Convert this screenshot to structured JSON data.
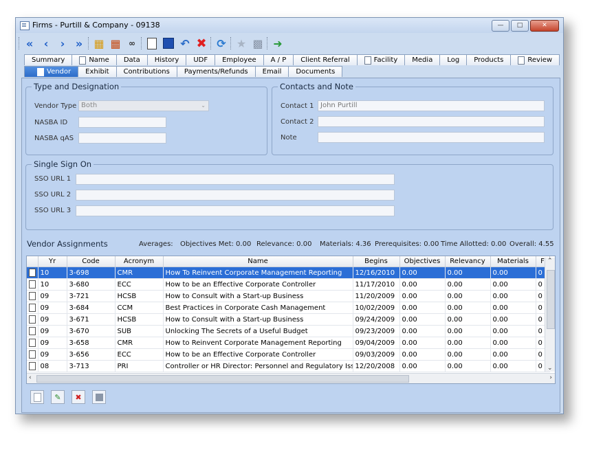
{
  "window": {
    "title": "Firms - Purtill & Company - 09138"
  },
  "toolbar": {
    "icons": [
      "first-icon",
      "prev-icon",
      "next-icon",
      "last-icon",
      "book-icon",
      "open-folder-icon",
      "glasses-icon",
      "new-document-icon",
      "save-icon",
      "undo-icon",
      "delete-icon",
      "refresh-icon",
      "star-icon",
      "printer-icon",
      "exit-icon"
    ]
  },
  "tabs_row1": [
    "Summary",
    "Name",
    "Data",
    "History",
    "UDF",
    "Employee",
    "A / P",
    "Client Referral",
    "Facility",
    "Media",
    "Log",
    "Products",
    "Review"
  ],
  "tabs_row2": [
    "Vendor",
    "Exhibit",
    "Contributions",
    "Payments/Refunds",
    "Email",
    "Documents"
  ],
  "type_designation": {
    "title": "Type and Designation",
    "vendor_type_label": "Vendor Type",
    "vendor_type_value": "Both",
    "nasba_id_label": "NASBA ID",
    "nasba_id_value": "",
    "nasba_qas_label": "NASBA qAS",
    "nasba_qas_value": ""
  },
  "contacts": {
    "title": "Contacts and Note",
    "contact1_label": "Contact 1",
    "contact1_value": "John Purtill",
    "contact2_label": "Contact 2",
    "contact2_value": "",
    "note_label": "Note",
    "note_value": ""
  },
  "sso": {
    "title": "Single Sign On",
    "url1_label": "SSO URL 1",
    "url2_label": "SSO URL 2",
    "url3_label": "SSO URL 3"
  },
  "vendor_assignments": {
    "title": "Vendor Assignments",
    "averages_label": "Averages:",
    "objectives_met": "Objectives Met:  0.00",
    "relevance": "Relevance:  0.00",
    "materials": "Materials:  4.36",
    "prerequisites": "Prerequisites:  0.00",
    "time_allotted": "Time Allotted:  0.00",
    "overall": "Overall:  4.55",
    "columns": [
      "",
      "Yr",
      "Code",
      "Acronym",
      "Name",
      "Begins",
      "Objectives",
      "Relevancy",
      "Materials",
      "F"
    ],
    "rows": [
      [
        "10",
        "3-698",
        "CMR",
        "How To Reinvent Corporate Management Reporting",
        "12/16/2010",
        "0.00",
        "0.00",
        "0.00",
        "0"
      ],
      [
        "10",
        "3-680",
        "ECC",
        "How to be an Effective Corporate Controller",
        "11/17/2010",
        "0.00",
        "0.00",
        "0.00",
        "0"
      ],
      [
        "09",
        "3-721",
        "HCSB",
        "How to Consult with a Start-up Business",
        "11/20/2009",
        "0.00",
        "0.00",
        "0.00",
        "0"
      ],
      [
        "09",
        "3-684",
        "CCM",
        "Best Practices in Corporate Cash Management",
        "10/02/2009",
        "0.00",
        "0.00",
        "0.00",
        "0"
      ],
      [
        "09",
        "3-671",
        "HCSB",
        "How to Consult with a Start-up Business",
        "09/24/2009",
        "0.00",
        "0.00",
        "0.00",
        "0"
      ],
      [
        "09",
        "3-670",
        "SUB",
        "Unlocking The Secrets of a Useful Budget",
        "09/23/2009",
        "0.00",
        "0.00",
        "0.00",
        "0"
      ],
      [
        "09",
        "3-658",
        "CMR",
        "How to Reinvent Corporate Management Reporting",
        "09/04/2009",
        "0.00",
        "0.00",
        "0.00",
        "0"
      ],
      [
        "09",
        "3-656",
        "ECC",
        "How to be an Effective Corporate Controller",
        "09/03/2009",
        "0.00",
        "0.00",
        "0.00",
        "0"
      ],
      [
        "08",
        "3-713",
        "PRI",
        "Controller or HR Director: Personnel and Regulatory Issues",
        "12/20/2008",
        "0.00",
        "0.00",
        "0.00",
        "0"
      ]
    ]
  }
}
